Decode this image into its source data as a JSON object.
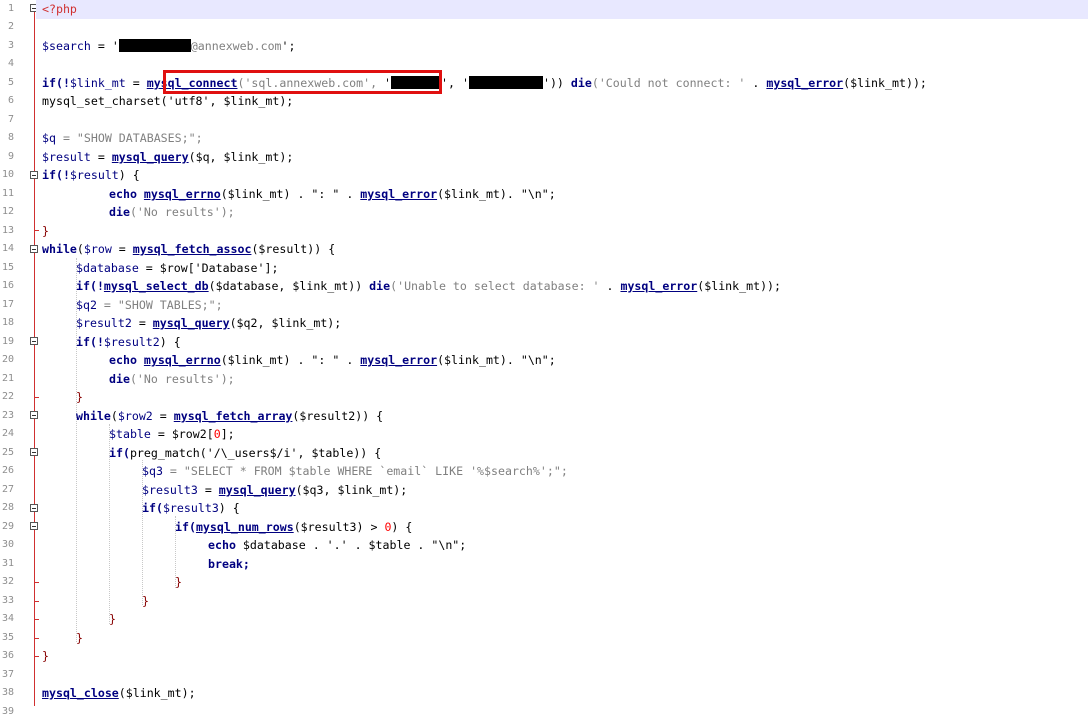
{
  "editor": {
    "line_numbers": [
      "1",
      "2",
      "3",
      "4",
      "5",
      "6",
      "7",
      "8",
      "9",
      "10",
      "11",
      "12",
      "13",
      "14",
      "15",
      "16",
      "17",
      "18",
      "19",
      "20",
      "21",
      "22",
      "23",
      "24",
      "25",
      "26",
      "27",
      "28",
      "29",
      "30",
      "31",
      "32",
      "33",
      "34",
      "35",
      "36",
      "37",
      "38",
      "39"
    ],
    "code": {
      "l1_open": "<?php",
      "l3_var": "$search",
      "l3_eq": " = '",
      "l3_domain": "@annexweb.com",
      "l3_end": "';",
      "l5_if": "if(!",
      "l5_var": "$link_mt",
      "l5_eq": " = ",
      "l5_fn": "mysql_connect",
      "l5_arg": "('sql.annexweb.com',",
      "l5_q1": " '",
      "l5_q2": "', '",
      "l5_q3": "'))",
      "l5_die": " die",
      "l5_msg": "('Could not connect: '",
      "l5_dot": " . ",
      "l5_err": "mysql_error",
      "l5_errarg": "($link_mt));",
      "l6": "mysql_set_charset('utf8', $link_mt);",
      "l8_var": "$q",
      "l8_str": " = \"SHOW DATABASES;\";",
      "l9_var": "$result",
      "l9_eq": " = ",
      "l9_fn": "mysql_query",
      "l9_args": "($q, $link_mt);",
      "l10_if": "if(!",
      "l10_var": "$result",
      "l10_end": ") {",
      "l11_echo": "echo ",
      "l11_fn": "mysql_errno",
      "l11_rest": "($link_mt) . \": \" . ",
      "l11_fn2": "mysql_error",
      "l11_rest2": "($link_mt). \"\\n\";",
      "l12_die": "die",
      "l12_msg": "('No results');",
      "l13": "}",
      "l14_while": "while",
      "l14_open": "(",
      "l14_var": "$row",
      "l14_eq": " = ",
      "l14_fn": "mysql_fetch_assoc",
      "l14_args": "($result)) {",
      "l15_var": "$database",
      "l15_rest": " = $row['Database'];",
      "l16_if": "if(!",
      "l16_fn": "mysql_select_db",
      "l16_args": "($database, $link_mt))",
      "l16_die": " die",
      "l16_msg": "('Unable to select database: '",
      "l16_dot": " . ",
      "l16_err": "mysql_error",
      "l16_errarg": "($link_mt));",
      "l17_var": "$q2",
      "l17_str": " = \"SHOW TABLES;\";",
      "l18_var": "$result2",
      "l18_eq": " = ",
      "l18_fn": "mysql_query",
      "l18_args": "($q2, $link_mt);",
      "l19_if": "if(!",
      "l19_var": "$result2",
      "l19_end": ") {",
      "l20_echo": "echo ",
      "l20_fn": "mysql_errno",
      "l20_rest": "($link_mt) . \": \" . ",
      "l20_fn2": "mysql_error",
      "l20_rest2": "($link_mt). \"\\n\";",
      "l21_die": "die",
      "l21_msg": "('No results');",
      "l22": "}",
      "l23_while": "while",
      "l23_open": "(",
      "l23_var": "$row2",
      "l23_eq": " = ",
      "l23_fn": "mysql_fetch_array",
      "l23_args": "($result2)) {",
      "l24_var": "$table",
      "l24_rest": " = $row2[",
      "l24_num": "0",
      "l24_end": "];",
      "l25_if": "if(",
      "l25_fn": "preg_match",
      "l25_args": "('/\\_users$/i', $table)) {",
      "l26_var": "$q3",
      "l26_str": " = \"SELECT * FROM $table WHERE `email` LIKE '%$search%';\";",
      "l27_var": "$result3",
      "l27_eq": " = ",
      "l27_fn": "mysql_query",
      "l27_args": "($q3, $link_mt);",
      "l28_if": "if(",
      "l28_var": "$result3",
      "l28_end": ") {",
      "l29_if": "if(",
      "l29_fn": "mysql_num_rows",
      "l29_args": "($result3) > ",
      "l29_num": "0",
      "l29_end": ") {",
      "l30_echo": "echo ",
      "l30_rest": "$database . '.' . $table . \"\\n\";",
      "l31_break": "break;",
      "l32": "}",
      "l33": "}",
      "l34": "}",
      "l35": "}",
      "l36": "}",
      "l38_fn": "mysql_close",
      "l38_args": "($link_mt);"
    }
  },
  "colors": {
    "highlight_box": "#e01010",
    "current_line": "#e8e8ff",
    "php_tag": "#d03030",
    "keyword": "#000080",
    "string": "#808080"
  }
}
